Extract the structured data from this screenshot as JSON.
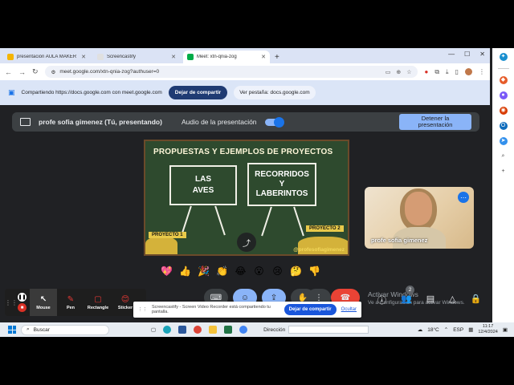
{
  "browser": {
    "tabs": [
      {
        "label": "presentación AULA MAKER",
        "icon_color": "#f4b400",
        "active": false
      },
      {
        "label": "Screencastify",
        "icon_color": "#5f6368",
        "active": false
      },
      {
        "label": "Meet: xtn-qnia-zog",
        "icon_color": "#00ac47",
        "active": true
      }
    ],
    "new_tab": "+",
    "url": "meet.google.com/xtn-qnia-zog?authuser=0"
  },
  "share_bar": {
    "text": "Compartiendo https://docs.google.com con meet.google.com",
    "stop_label": "Dejar de compartir",
    "view_label": "Ver pestaña: docs.google.com"
  },
  "presentation_bar": {
    "presenter": "profe sofia gimenez (Tú, presentando)",
    "audio_label": "Audio de la presentación",
    "stop_label_line1": "Detener la",
    "stop_label_line2": "presentación"
  },
  "slide": {
    "title": "PROPUESTAS Y EJEMPLOS DE PROYECTOS",
    "board1_line1": "LAS",
    "board1_line2": "AVES",
    "board2_line1": "RECORRIDOS",
    "board2_line2": "Y",
    "board2_line3": "LABERINTOS",
    "project1": "PROYECTO 1",
    "project2": "PROYECTO 2",
    "handle": "@profesofiagimenez"
  },
  "participant": {
    "name": "profe sofia gimenez"
  },
  "reactions": [
    "💖",
    "👍",
    "🎉",
    "👏",
    "😂",
    "😮",
    "😢",
    "🤔",
    "👎"
  ],
  "controls": {
    "activate_line1": "Activar Windows",
    "activate_line2": "Ve a Configuración para activar Windows.",
    "people_badge": "2"
  },
  "screencastify": {
    "tools": [
      {
        "label": "Mouse",
        "icon": "↖"
      },
      {
        "label": "Pen",
        "icon": "✎"
      },
      {
        "label": "Rectangle",
        "icon": "▢"
      },
      {
        "label": "Sticker",
        "icon": "😊"
      }
    ],
    "notification": "Screencastify - Screen Video Recorder está compartiendo tu pantalla.",
    "stop_label": "Dejar de compartir",
    "hide_label": "Ocultar"
  },
  "taskbar": {
    "search_label": "Buscar",
    "direccion_label": "Dirección",
    "weather": "18°C",
    "lang": "ESP",
    "time": "11:17",
    "date": "12/4/2024"
  }
}
